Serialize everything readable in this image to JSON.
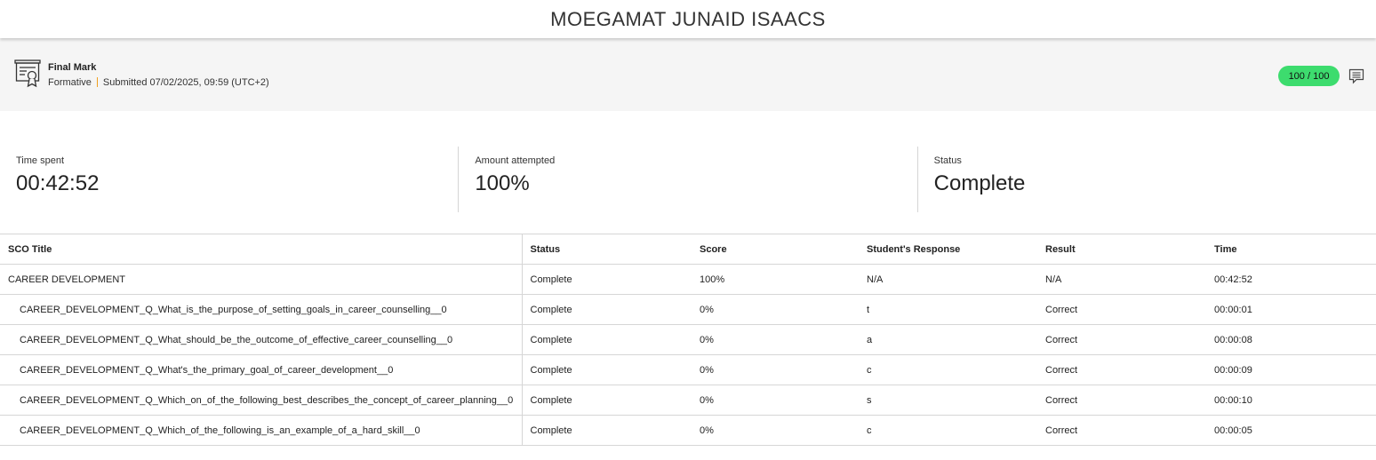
{
  "header": {
    "title": "MOEGAMAT JUNAID ISAACS"
  },
  "mark": {
    "icon": "certificate-icon",
    "title": "Final Mark",
    "type": "Formative",
    "submitted": "Submitted 07/02/2025, 09:59 (UTC+2)",
    "score": "100 / 100",
    "score_color": "#3ddc6e",
    "comment_icon": "comment-icon"
  },
  "stats": [
    {
      "label": "Time spent",
      "value": "00:42:52"
    },
    {
      "label": "Amount attempted",
      "value": "100%"
    },
    {
      "label": "Status",
      "value": "Complete"
    }
  ],
  "table": {
    "columns": [
      "SCO Title",
      "Status",
      "Score",
      "Student's Response",
      "Result",
      "Time"
    ],
    "rows": [
      [
        "CAREER DEVELOPMENT",
        "Complete",
        "100%",
        "N/A",
        "N/A",
        "00:42:52"
      ],
      [
        "CAREER_DEVELOPMENT_Q_What_is_the_purpose_of_setting_goals_in_career_counselling__0",
        "Complete",
        "0%",
        "t",
        "Correct",
        "00:00:01"
      ],
      [
        "CAREER_DEVELOPMENT_Q_What_should_be_the_outcome_of_effective_career_counselling__0",
        "Complete",
        "0%",
        "a",
        "Correct",
        "00:00:08"
      ],
      [
        "CAREER_DEVELOPMENT_Q_What's_the_primary_goal_of_career_development__0",
        "Complete",
        "0%",
        "c",
        "Correct",
        "00:00:09"
      ],
      [
        "CAREER_DEVELOPMENT_Q_Which_on_of_the_following_best_describes_the_concept_of_career_planning__0",
        "Complete",
        "0%",
        "s",
        "Correct",
        "00:00:10"
      ],
      [
        "CAREER_DEVELOPMENT_Q_Which_of_the_following_is_an_example_of_a_hard_skill__0",
        "Complete",
        "0%",
        "c",
        "Correct",
        "00:00:05"
      ]
    ]
  }
}
